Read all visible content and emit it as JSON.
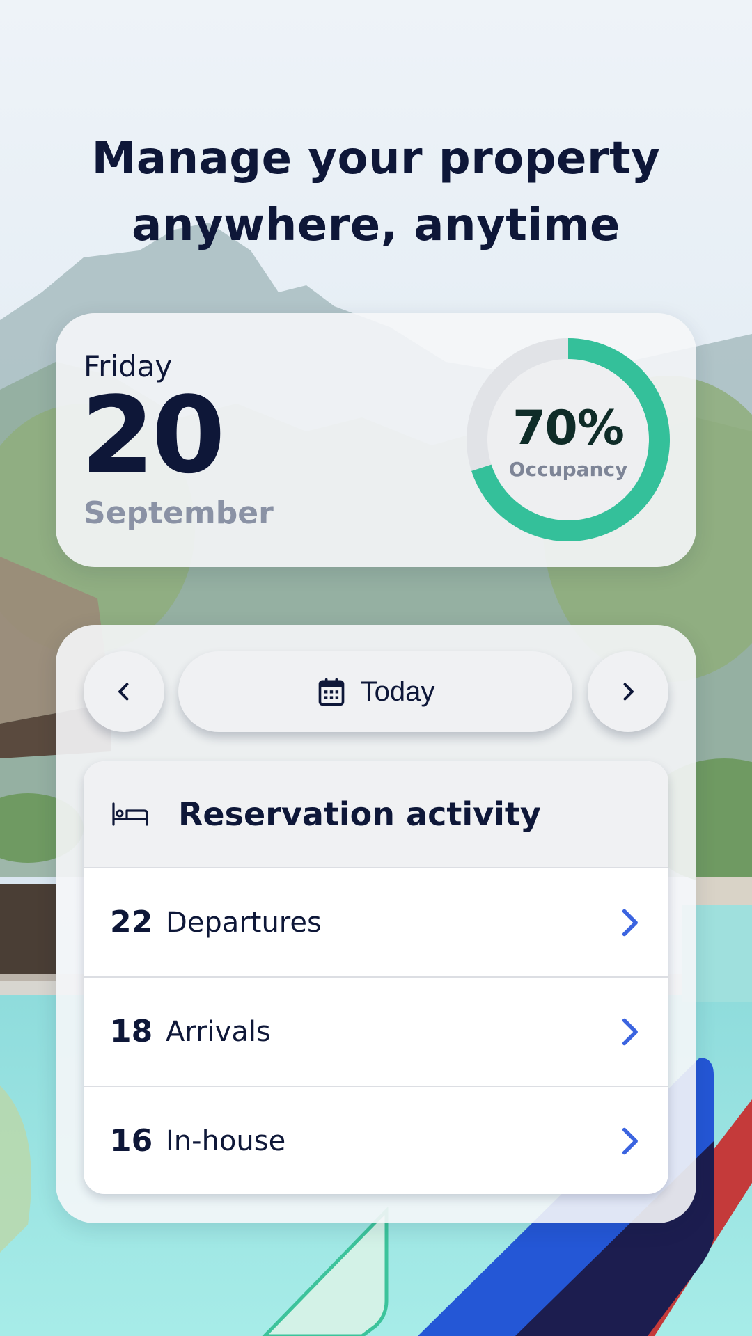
{
  "headline": {
    "line1": "Manage your property",
    "line2": "anywhere, anytime"
  },
  "date_card": {
    "weekday": "Friday",
    "day": "20",
    "month": "September",
    "occupancy": {
      "value_text": "70%",
      "label": "Occupancy",
      "percent": 70,
      "accent_color": "#34c09a",
      "track_color": "#e1e3e7"
    }
  },
  "navigation": {
    "prev_icon": "chevron-left-icon",
    "next_icon": "chevron-right-icon",
    "today_icon": "calendar-icon",
    "today_label": "Today"
  },
  "reservation_activity": {
    "icon": "bed-icon",
    "title": "Reservation activity",
    "rows": [
      {
        "count": "22",
        "label": "Departures"
      },
      {
        "count": "18",
        "label": "Arrivals"
      },
      {
        "count": "16",
        "label": "In-house"
      }
    ],
    "chevron_color": "#3b64e0"
  },
  "colors": {
    "navy": "#0e1738",
    "muted": "#8a92a5",
    "accent_green": "#34c09a",
    "link_blue": "#3b64e0"
  }
}
